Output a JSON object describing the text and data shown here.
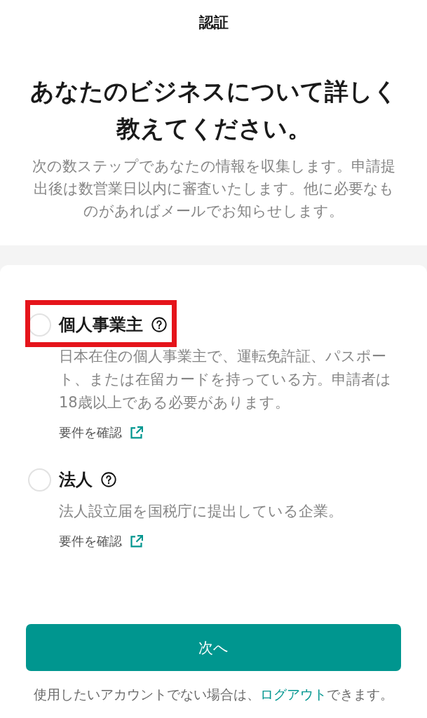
{
  "header": {
    "title": "認証"
  },
  "intro": {
    "heading": "あなたのビジネスについて詳しく教えてください。",
    "description": "次の数ステップであなたの情報を収集します。申請提出後は数営業日以内に審査いたします。他に必要なものがあればメールでお知らせします。"
  },
  "options": [
    {
      "label": "個人事業主",
      "selected": false,
      "highlighted": true,
      "description": "日本在住の個人事業主で、運転免許証、パスポート、または在留カードを持っている方。申請者は18歳以上である必要があります。",
      "link": "要件を確認"
    },
    {
      "label": "法人",
      "selected": false,
      "highlighted": false,
      "description": "法人設立届を国税庁に提出している企業。",
      "link": "要件を確認"
    }
  ],
  "primary_button": {
    "label": "次へ"
  },
  "footer": {
    "text_before": "使用したいアカウントでない場合は、",
    "link": "ログアウト",
    "text_after": "できます。"
  }
}
